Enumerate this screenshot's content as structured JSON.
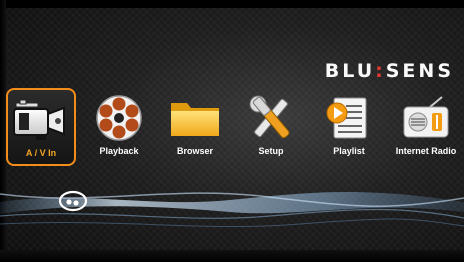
{
  "brand": {
    "name_left": "BLU",
    "separator": ":",
    "name_right": "SENS"
  },
  "menu": {
    "items": [
      {
        "label": "A / V In",
        "icon": "camcorder-icon",
        "selected": true
      },
      {
        "label": "Playback",
        "icon": "film-reel-icon",
        "selected": false
      },
      {
        "label": "Browser",
        "icon": "folder-icon",
        "selected": false
      },
      {
        "label": "Setup",
        "icon": "tools-icon",
        "selected": false
      },
      {
        "label": "Playlist",
        "icon": "playlist-icon",
        "selected": false
      },
      {
        "label": "Internet Radio",
        "icon": "radio-icon",
        "selected": false
      }
    ]
  },
  "colors": {
    "accent": "#f28c1a",
    "selected_label": "#f5a623",
    "brand_dots": "#e53935"
  },
  "decor": {
    "disc_icon": "disc-icon"
  }
}
